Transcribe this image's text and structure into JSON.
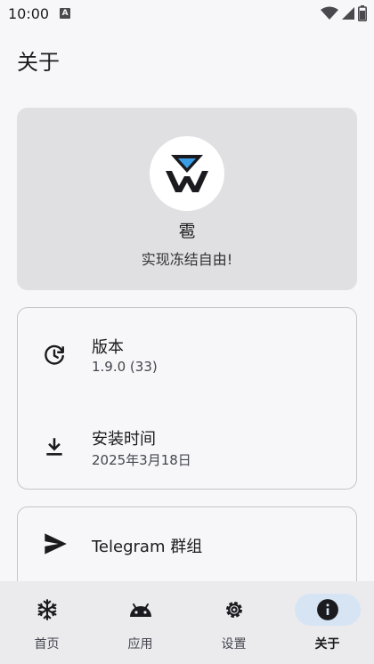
{
  "status_bar": {
    "time": "10:00",
    "notification_letter": "A"
  },
  "page": {
    "title": "关于"
  },
  "app": {
    "name": "雹",
    "slogan": "实现冻结自由!"
  },
  "info": [
    {
      "icon": "update-history-icon",
      "title": "版本",
      "value": "1.9.0 (33)"
    },
    {
      "icon": "download-icon",
      "title": "安装时间",
      "value": "2025年3月18日"
    }
  ],
  "links": [
    {
      "icon": "send-icon",
      "title": "Telegram 群组"
    }
  ],
  "bottom_nav": {
    "items": [
      {
        "icon": "snowflake-icon",
        "label": "首页",
        "active": false
      },
      {
        "icon": "android-icon",
        "label": "应用",
        "active": false
      },
      {
        "icon": "gear-icon",
        "label": "设置",
        "active": false
      },
      {
        "icon": "info-icon",
        "label": "关于",
        "active": true
      }
    ]
  },
  "colors": {
    "accent_pill": "#d6e4f4",
    "hero_bg": "#e0e0e2",
    "logo_blue": "#3a9ee6"
  }
}
